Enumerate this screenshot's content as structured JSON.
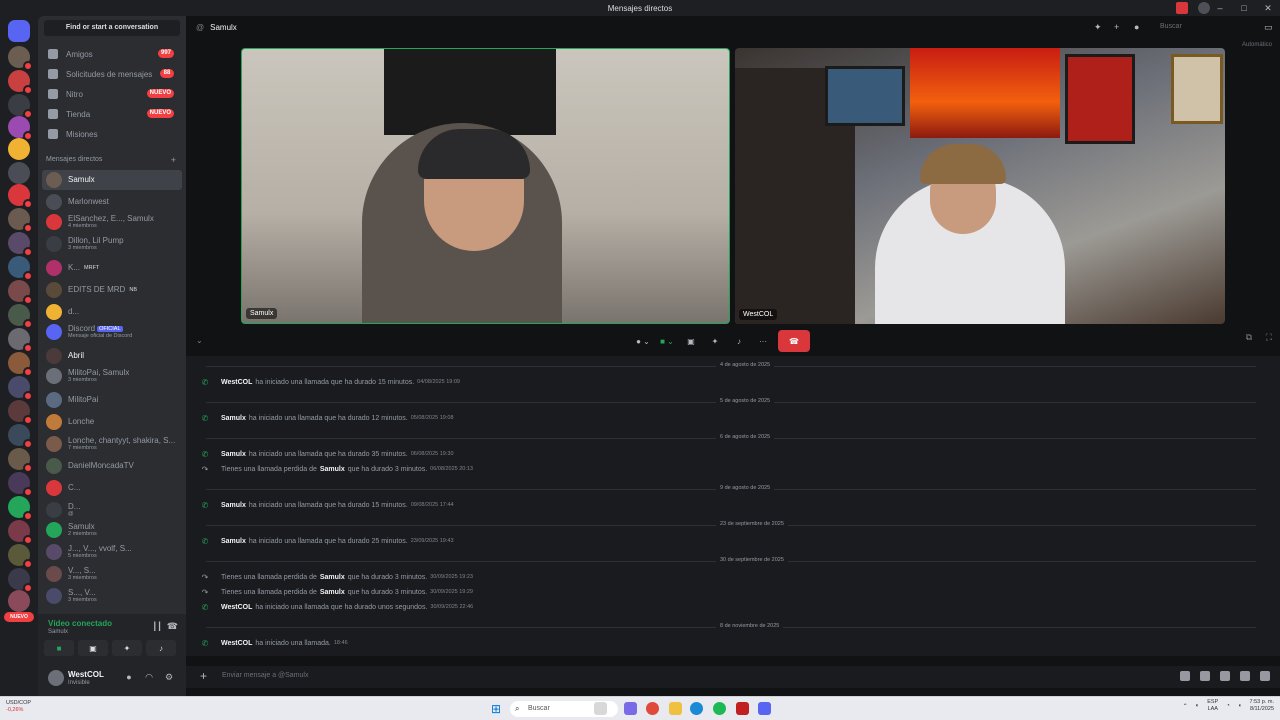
{
  "window": {
    "title": "Mensajes directos"
  },
  "sidebar": {
    "find_placeholder": "Find or start a conversation",
    "nav": [
      {
        "label": "Amigos",
        "badge": "997"
      },
      {
        "label": "Solicitudes de mensajes",
        "badge": "88"
      },
      {
        "label": "Nitro",
        "badge": "NUEVO"
      },
      {
        "label": "Tienda",
        "badge": "NUEVO"
      },
      {
        "label": "Misiones",
        "badge": ""
      }
    ],
    "dm_header": "Mensajes directos",
    "dms": [
      {
        "name": "Samulx",
        "sub": "",
        "active": true,
        "color": "#6b5d52"
      },
      {
        "name": "Marlonwest",
        "sub": "",
        "color": "#4a4d55"
      },
      {
        "name": "ElSanchez, E..., Samulx",
        "sub": "4 miembros",
        "color": "#da373c"
      },
      {
        "name": "Dillon, Lil Pump",
        "sub": "3 miembros",
        "color": "#3b3d44"
      },
      {
        "name": "K...",
        "tag": "MRFT",
        "sub": "",
        "color": "#b0306a"
      },
      {
        "name": "EDITS DE MRD",
        "tag": "NB",
        "sub": "",
        "color": "#5a4a3a"
      },
      {
        "name": "d...",
        "sub": "",
        "color": "#f0b232"
      },
      {
        "name": "Discord",
        "tag": "OFICIAL",
        "sub": "Mensaje oficial de Discord",
        "color": "#5865f2"
      },
      {
        "name": "Abril",
        "sub": "",
        "color": "#4a3a3a",
        "bright": true
      },
      {
        "name": "MilitoPai, Samulx",
        "sub": "3 miembros",
        "color": "#6b6f78"
      },
      {
        "name": "MilitoPai",
        "sub": "",
        "color": "#5a6a80"
      },
      {
        "name": "Lonche",
        "sub": "",
        "color": "#c07a3a"
      },
      {
        "name": "Lonche, chantyyt, shakira, S...",
        "sub": "7 miembros",
        "color": "#7a5a4a"
      },
      {
        "name": "DanielMoncadaTV",
        "sub": "",
        "color": "#4a5a4a"
      },
      {
        "name": "C...",
        "sub": "",
        "color": "#da373c"
      },
      {
        "name": "D...",
        "sub": "@",
        "color": "#3b3d44"
      },
      {
        "name": "Samulx",
        "sub": "2 miembros",
        "color": "#23a55a"
      },
      {
        "name": "J..., V..., vvolf, S...",
        "sub": "5 miembros",
        "color": "#5a4a6a"
      },
      {
        "name": "V..., S...",
        "sub": "3 miembros",
        "color": "#6a4a4a"
      },
      {
        "name": "S..., V...",
        "sub": "3 miembros",
        "color": "#4a4a6a"
      }
    ],
    "rail_nuevo": "NUEVO"
  },
  "voice": {
    "title": "Vídeo conectado",
    "channel": "Samulx"
  },
  "user": {
    "name": "WestCOL",
    "status": "Invisible"
  },
  "main": {
    "header_name": "Samulx",
    "search_placeholder": "Buscar",
    "auto_label": "Automático",
    "tiles": [
      {
        "label": "Samulx"
      },
      {
        "label": "WestCOL"
      }
    ]
  },
  "chat": {
    "dividers": [
      "4 de agosto de 2025",
      "5 de agosto de 2025",
      "6 de agosto de 2025",
      "9 de agosto de 2025",
      "23 de septiembre de 2025",
      "30 de septiembre de 2025",
      "8 de noviembre de 2025"
    ],
    "calls": [
      {
        "pre": "",
        "name": "WestCOL",
        "text": "ha iniciado una llamada que ha durado 15 minutos.",
        "ts": "04/08/2025 19:09",
        "missed": false
      },
      {
        "pre": "",
        "name": "Samulx",
        "text": "ha iniciado una llamada que ha durado 12 minutos.",
        "ts": "05/08/2025 19:08",
        "missed": false
      },
      {
        "pre": "",
        "name": "Samulx",
        "text": "ha iniciado una llamada que ha durado 35 minutos.",
        "ts": "06/08/2025 19:30",
        "missed": false
      },
      {
        "pre": "Tienes una llamada perdida de",
        "name": "Samulx",
        "text": "que ha durado 3 minutos.",
        "ts": "06/08/2025 20:13",
        "missed": true
      },
      {
        "pre": "",
        "name": "Samulx",
        "text": "ha iniciado una llamada que ha durado 15 minutos.",
        "ts": "09/08/2025 17:44",
        "missed": false
      },
      {
        "pre": "",
        "name": "Samulx",
        "text": "ha iniciado una llamada que ha durado 25 minutos.",
        "ts": "23/09/2025 19:43",
        "missed": false
      },
      {
        "pre": "Tienes una llamada perdida de",
        "name": "Samulx",
        "text": "que ha durado 3 minutos.",
        "ts": "30/09/2025 19:23",
        "missed": true
      },
      {
        "pre": "Tienes una llamada perdida de",
        "name": "Samulx",
        "text": "que ha durado 3 minutos.",
        "ts": "30/09/2025 19:29",
        "missed": true
      },
      {
        "pre": "",
        "name": "WestCOL",
        "text": "ha iniciado una llamada que ha durado unos segundos.",
        "ts": "30/09/2025 22:46",
        "missed": false
      },
      {
        "pre": "",
        "name": "WestCOL",
        "text": "ha iniciado una llamada.",
        "ts": "18:46",
        "missed": false
      }
    ],
    "composer_placeholder": "Enviar mensaje a @Samulx"
  },
  "taskbar": {
    "ticker_label": "USD/COP",
    "ticker_value": "-0,26%",
    "search": "Buscar",
    "lang_top": "ESP",
    "lang_bottom": "LAA",
    "time": "7:53 p. m.",
    "date": "8/11/2025"
  }
}
